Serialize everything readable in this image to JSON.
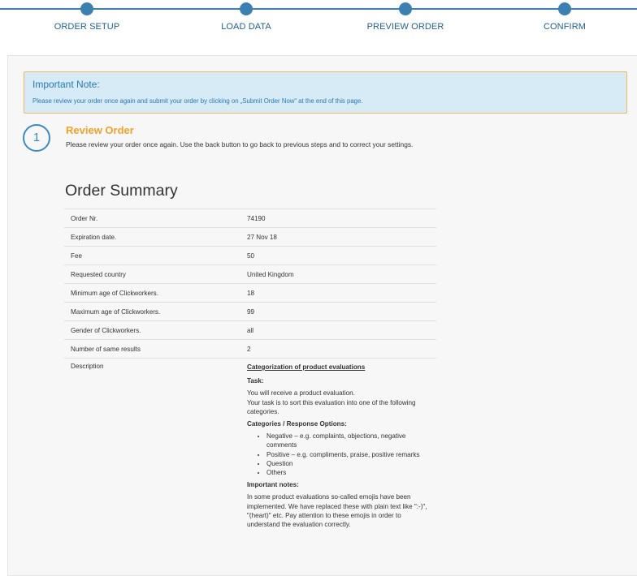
{
  "stepper": {
    "steps": [
      "ORDER SETUP",
      "LOAD DATA",
      "PREVIEW ORDER",
      "CONFIRM"
    ]
  },
  "note": {
    "title": "Important Note:",
    "text": "Please review your order once again and submit your order by clicking on „Submit Order Now“ at the end of this page."
  },
  "review": {
    "number": "1",
    "title": "Review Order",
    "description": "Please review your order once again. Use the back button to go back to previous steps and to correct your settings."
  },
  "summary": {
    "title": "Order Summary",
    "rows": [
      {
        "label": "Order Nr.",
        "value": "74190"
      },
      {
        "label": "Expiration date.",
        "value": "27 Nov 18"
      },
      {
        "label": "Fee",
        "value": "50"
      },
      {
        "label": "Requested country",
        "value": "United Kingdom"
      },
      {
        "label": "Minimum age of Clickworkers.",
        "value": "18"
      },
      {
        "label": "Maximum age of Clickworkers.",
        "value": "99"
      },
      {
        "label": "Gender of Clickworkers.",
        "value": "all"
      },
      {
        "label": "Number of same results",
        "value": "2"
      }
    ],
    "description": {
      "label": "Description",
      "heading": "Categorization of product evaluations",
      "task_title": "Task:",
      "task_line1": "You will receive a product evaluation.",
      "task_line2": "Your task is to sort this evaluation into one of the following categories.",
      "categories_title": "Categories / Response Options:",
      "categories": [
        "Negative – e.g. complaints, objections, negative comments",
        "Positive – e.g. compliments, praise, positive remarks",
        "Question",
        "Others"
      ],
      "notes_title": "Important notes:",
      "notes_text": "In some product evaluations so-called emojis have been implemented. We have replaced these with plain text like \":-)\", \"(heart)\" etc. Pay attention to these emojis in order to understand the evaluation correctly."
    }
  }
}
